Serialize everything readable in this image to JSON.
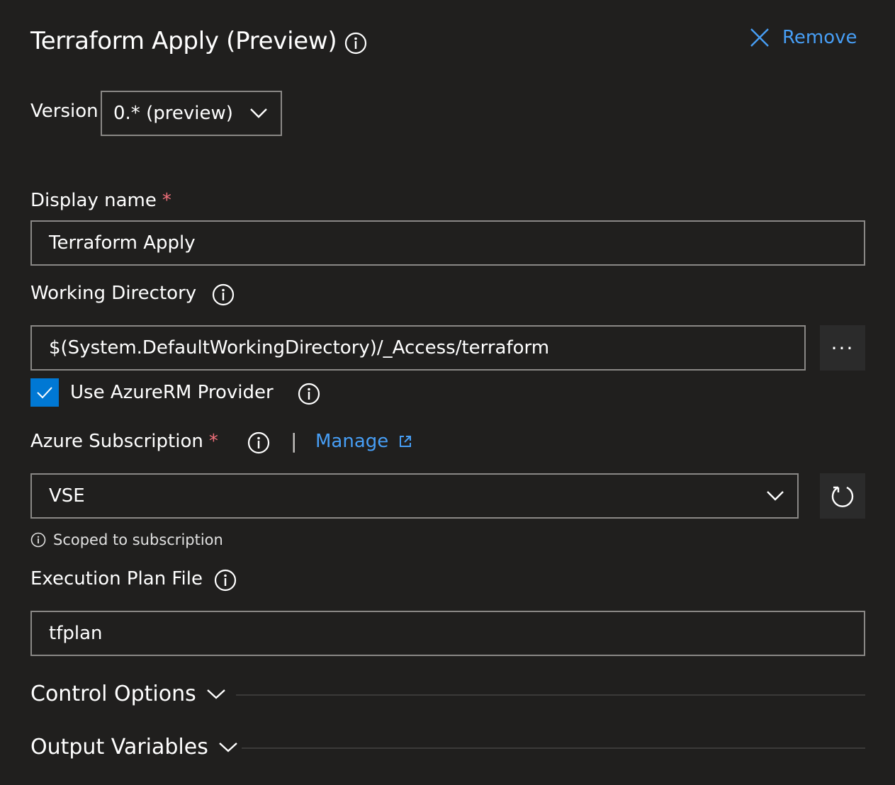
{
  "header": {
    "title": "Terraform Apply (Preview)",
    "remove_label": "Remove"
  },
  "version": {
    "label": "Version",
    "selected": "0.* (preview)"
  },
  "display_name": {
    "label": "Display name",
    "required_mark": "*",
    "value": "Terraform Apply"
  },
  "working_directory": {
    "label": "Working Directory",
    "value": "$(System.DefaultWorkingDirectory)/_Access/terraform",
    "browse_label": "···"
  },
  "use_azurerm": {
    "label": "Use AzureRM Provider",
    "checked": true
  },
  "azure_subscription": {
    "label": "Azure Subscription",
    "required_mark": "*",
    "separator": "|",
    "manage_label": "Manage",
    "selected": "VSE",
    "hint": "Scoped to subscription"
  },
  "execution_plan": {
    "label": "Execution Plan File",
    "value": "tfplan"
  },
  "sections": {
    "control_options": "Control Options",
    "output_variables": "Output Variables"
  },
  "colors": {
    "background": "#201f1e",
    "accent": "#479ef5",
    "checkbox": "#0078d4",
    "required": "#f1707b",
    "border": "#8a8886"
  }
}
